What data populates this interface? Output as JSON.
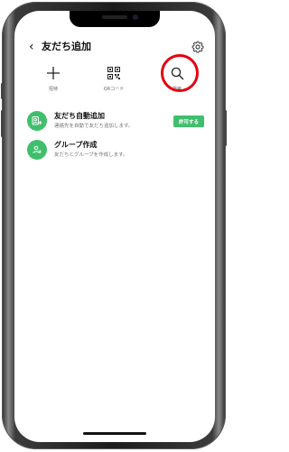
{
  "header": {
    "back_icon": "chevron-left-icon",
    "title": "友だち追加",
    "settings_icon": "gear-icon"
  },
  "actions": [
    {
      "icon": "plus-icon",
      "label": "招待"
    },
    {
      "icon": "qr-code-icon",
      "label": "QRコード"
    },
    {
      "icon": "search-icon",
      "label": "検索",
      "highlighted": true
    }
  ],
  "list": [
    {
      "icon": "auto-add-friend-icon",
      "title": "友だち自動追加",
      "subtitle": "連絡先を自動で友だち追加します。",
      "button": "許可する"
    },
    {
      "icon": "group-icon",
      "title": "グループ作成",
      "subtitle": "友だちとグループを作成します。"
    }
  ],
  "colors": {
    "accent": "#3fbf6c",
    "highlight_ring": "#e60012"
  }
}
